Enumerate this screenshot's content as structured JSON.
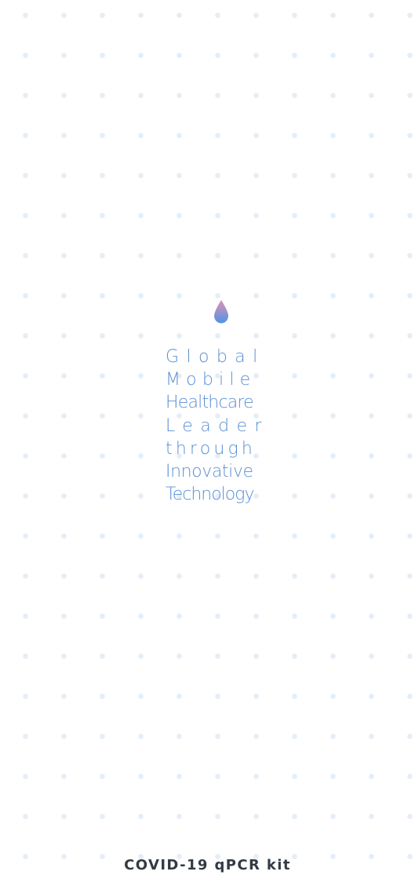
{
  "tagline": {
    "lines": [
      "Global",
      "Mobile",
      "Healthcare",
      "Leader",
      "through",
      "Innovative",
      "Technology"
    ]
  },
  "logo": {
    "icon": "water-drop-icon",
    "gradient_top": "#e48fb8",
    "gradient_bottom": "#4f95e4"
  },
  "product": {
    "title": "COVID-19 qPCR kit"
  },
  "colors": {
    "background": "#ffffff",
    "dot": "#e3eef8",
    "tagline": "#5b8fd4",
    "product_text": "#333a44"
  }
}
